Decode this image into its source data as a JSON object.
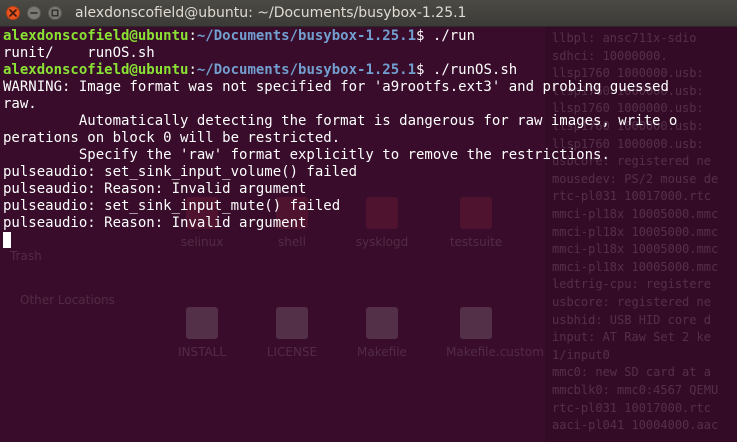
{
  "window": {
    "title": "alexdonscofield@ubuntu: ~/Documents/busybox-1.25.1"
  },
  "terminal": {
    "commands": [
      {
        "user": "alexdonscofield@ubuntu",
        "sep": ":",
        "path": "~/Documents/busybox-1.25.1",
        "symbol": "$ ",
        "command": "./run"
      },
      {
        "user": "alexdonscofield@ubuntu",
        "sep": ":",
        "path": "~/Documents/busybox-1.25.1",
        "symbol": "$ ",
        "command": "./runOS.sh"
      }
    ],
    "ls_output": "runit/    runOS.sh",
    "output": [
      "WARNING: Image format was not specified for 'a9rootfs.ext3' and probing guessed",
      "raw.",
      "         Automatically detecting the format is dangerous for raw images, write o",
      "perations on block 0 will be restricted.",
      "         Specify the 'raw' format explicitly to remove the restrictions.",
      "pulseaudio: set_sink_input_volume() failed",
      "pulseaudio: Reason: Invalid argument",
      "pulseaudio: set_sink_input_mute() failed",
      "pulseaudio: Reason: Invalid argument"
    ]
  },
  "background": {
    "sidebar": [
      "Trash",
      "Other Locations"
    ],
    "files_row1": [
      "selinux",
      "shell",
      "sysklogd",
      "testsuite"
    ],
    "files_row2": [
      "INSTALL",
      "LICENSE",
      "Makefile",
      "Makefile.custom"
    ],
    "dmesg": [
      "llbpl: ansc711x-sdio",
      "sdhci: 10000000.",
      "llsp1760 1000000.usb:",
      "llsp1760 1000000.usb:",
      "llsp1760 1000000.usb:",
      "llsp1760 1000000.usb:",
      "llsp1760 1000000.usb:",
      "usbcore: registered ne",
      "mousedev: PS/2 mouse de",
      "rtc-pl031 10017000.rtc",
      "mmci-pl18x 10005000.mmc",
      "mmci-pl18x 10005000.mmc",
      "mmci-pl18x 10005000.mmc",
      "mmci-pl18x 10005000.mmc",
      "ledtrig-cpu: registere",
      "usbcore: registered ne",
      "usbhid: USB HID core d",
      "input: AT Raw Set 2 ke",
      "1/input0",
      "mmc0: new SD card at a",
      "mmcblk0: mmc0:4567 QEMU",
      "rtc-pl031 10017000.rtc",
      "aaci-pl041 10004000.aac"
    ]
  }
}
